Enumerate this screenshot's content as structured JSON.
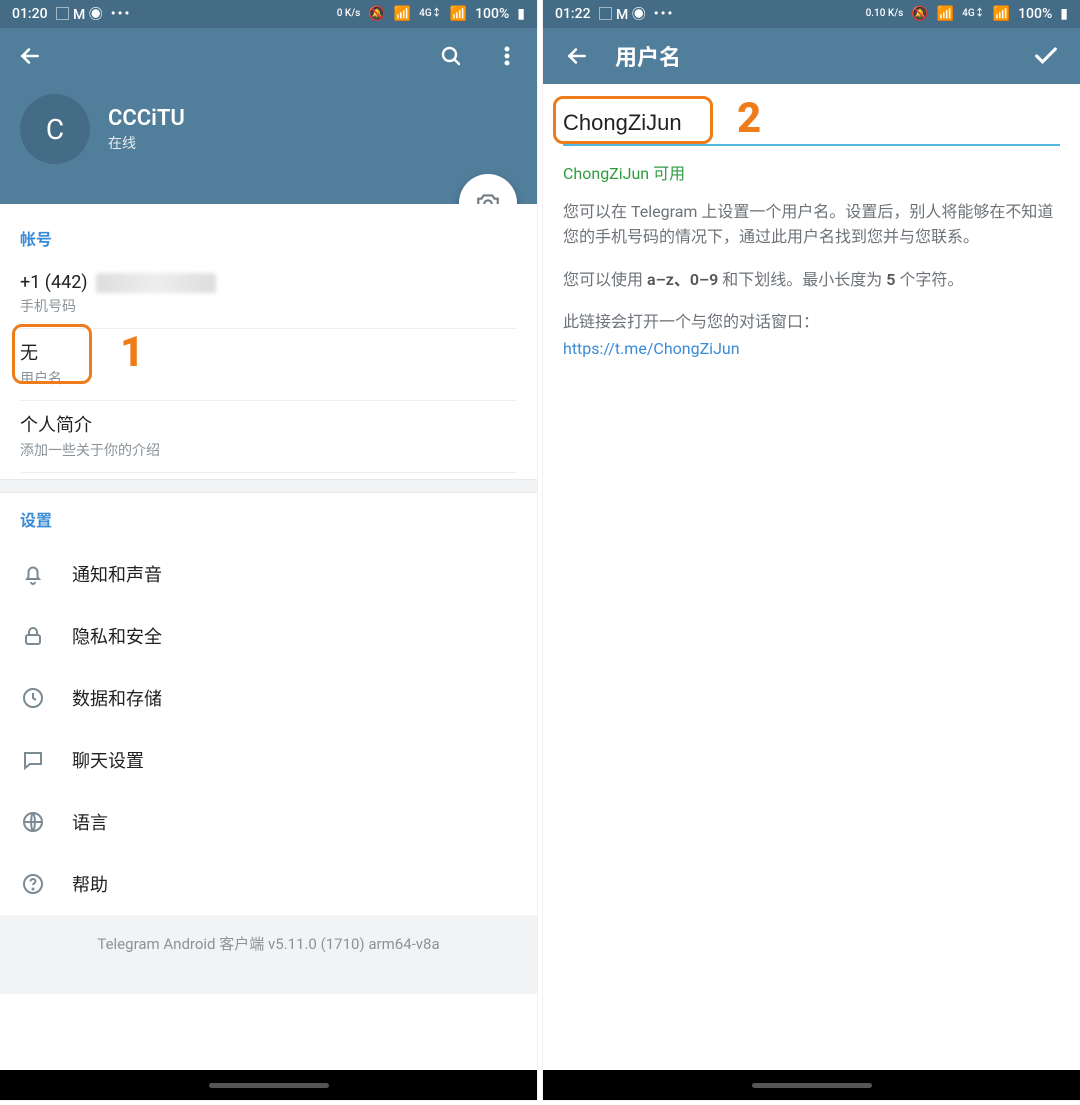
{
  "left": {
    "status": {
      "time": "01:20",
      "net": "0 K/s",
      "battery": "100%"
    },
    "profile": {
      "avatar_letter": "C",
      "name": "CCCiTU",
      "status": "在线"
    },
    "account": {
      "header": "帐号",
      "phone": {
        "prefix": "+1 (442)",
        "label": "手机号码"
      },
      "username": {
        "value": "无",
        "label": "用户名"
      },
      "bio": {
        "value": "个人简介",
        "label": "添加一些关于你的介绍"
      }
    },
    "settings": {
      "header": "设置",
      "items": [
        {
          "icon": "bell",
          "label": "通知和声音"
        },
        {
          "icon": "lock",
          "label": "隐私和安全"
        },
        {
          "icon": "clock",
          "label": "数据和存储"
        },
        {
          "icon": "chat",
          "label": "聊天设置"
        },
        {
          "icon": "globe",
          "label": "语言"
        },
        {
          "icon": "help",
          "label": "帮助"
        }
      ]
    },
    "version": "Telegram Android 客户端 v5.11.0 (1710) arm64-v8a",
    "annotation_num": "1"
  },
  "right": {
    "status": {
      "time": "01:22",
      "net": "0.10 K/s",
      "battery": "100%"
    },
    "appbar_title": "用户名",
    "input_value": "ChongZiJun",
    "avail_text": "ChongZiJun 可用",
    "desc1": "您可以在 Telegram 上设置一个用户名。设置后，别人将能够在不知道您的手机号码的情况下，通过此用户名找到您并与您联系。",
    "desc2_pre": "您可以使用 ",
    "desc2_b1": "a–z、0–9",
    "desc2_mid": " 和下划线。最小长度为 ",
    "desc2_b2": "5",
    "desc2_post": " 个字符。",
    "desc3": "此链接会打开一个与您的对话窗口：",
    "link": "https://t.me/ChongZiJun",
    "annotation_num": "2"
  }
}
